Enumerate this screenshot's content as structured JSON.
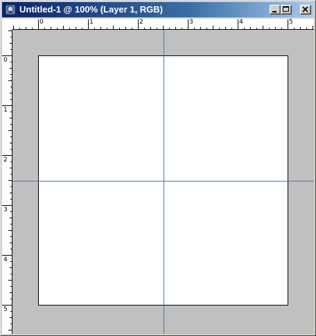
{
  "window": {
    "title": "Untitled-1 @ 100% (Layer 1, RGB)",
    "icon": "photoshop-document-icon",
    "controls": [
      "minimize-icon",
      "maximize-icon",
      "close-icon"
    ]
  },
  "rulers": {
    "unit": "inches",
    "horizontal_labels": [
      "0",
      "1",
      "2",
      "3",
      "4",
      "5"
    ],
    "vertical_labels": [
      "0",
      "1",
      "2",
      "3",
      "4",
      "5"
    ]
  },
  "document": {
    "zoom": "100%",
    "layer": "Layer 1",
    "mode": "RGB",
    "background": "#ffffff",
    "pasteboard_color": "#c0c0c0"
  },
  "guides": {
    "color": "#3d78c4",
    "vertical_at_inches": 2.5,
    "horizontal_at_inches": 2.5
  }
}
